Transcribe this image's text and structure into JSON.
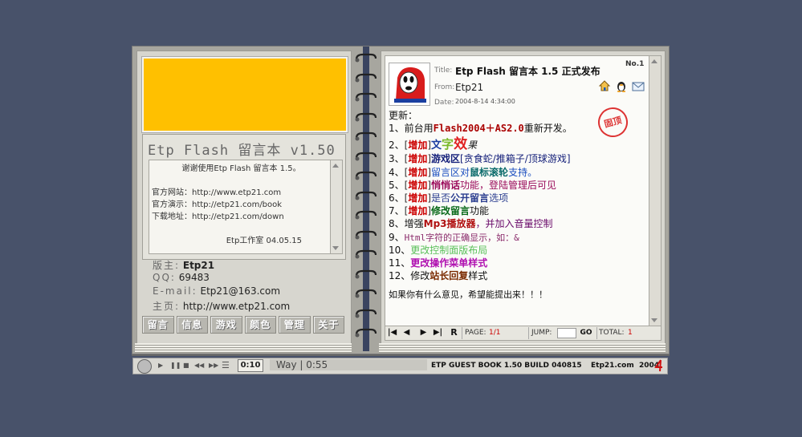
{
  "left": {
    "app_title": "Etp Flash 留言本 v1.50",
    "notice": {
      "lines": [
        "谢谢使用Etp Flash 留言本 1.5。",
        "",
        "官方网站：http://www.etp21.com",
        "官方演示：http://etp21.com/book",
        "下载地址：http://etp21.com/down",
        "",
        "Etp工作室 04.05.15"
      ]
    },
    "info": {
      "owner_label": "版主:",
      "owner": "Etp21",
      "qq_label": "QQ:",
      "qq": "69483",
      "email_label": "E-mail:",
      "email": "Etp21@163.com",
      "home_label": "主页:",
      "home": "http://www.etp21.com"
    },
    "nav": [
      "留言",
      "信息",
      "游戏",
      "颜色",
      "管理",
      "关于"
    ]
  },
  "message": {
    "no": "No.1",
    "title_label": "Title:",
    "title": "Etp Flash 留言本 1.5 正式发布",
    "from_label": "From:",
    "from": "Etp21",
    "date_label": "Date:",
    "date": "2004-8-14 4:34:00",
    "stamp": "固顶",
    "heading": "更新：",
    "item1_pre": "1、前台用",
    "item1_bold": "Flash2004＋AS2.0",
    "item1_post": "重新开发。",
    "item2_num": "2、",
    "item3_num": "3、",
    "item4_num": "4、",
    "item5_num": "5、",
    "item6_num": "6、",
    "item7_num": "7、",
    "add_tag": "增加",
    "lb": "[",
    "rb": "]",
    "item2_a": "文",
    "item2_b": "字",
    "item2_c": "效",
    "item2_d": "果",
    "item3_a": "游戏区",
    "item3_b": "[贪食蛇/推箱子/顶球游戏]",
    "item4_a": "留言区对",
    "item4_b": "鼠标滚轮",
    "item4_c": "支持。",
    "item5_a": "悄悄话",
    "item5_b": "功能，登陆管理后可见",
    "item6_a": "是否",
    "item6_b": "公开留言",
    "item6_c": "选项",
    "item7_a": "修改留言",
    "item7_b": "功能",
    "item8_pre": "8、增强",
    "item8_bold": "Mp3播放器",
    "item8_post": "，并加入音量控制",
    "item9_pre": "9、",
    "item9_text": "Html字符的正确显示，如：&",
    "item10_pre": "10、",
    "item10_text": "更改控制面版布局",
    "item11_pre": "11、",
    "item11_text": "更改操作菜单样式",
    "item12_pre": "12、修改",
    "item12_bold": "站长回复",
    "item12_post": "样式",
    "closing": "如果你有什么意见，希望能提出来！！！"
  },
  "pager": {
    "first_icon": "first-page-icon",
    "prev_icon": "prev-page-icon",
    "next_icon": "next-page-icon",
    "last_icon": "last-page-icon",
    "refresh": "R",
    "page_label": "PAGE:",
    "page": "1/1",
    "jump_label": "JUMP:",
    "jump_value": "",
    "go": "GO",
    "total_label": "TOTAL:",
    "total": "1"
  },
  "player": {
    "time": "0:10",
    "track": "Way | 0:55",
    "build": "ETP GUEST BOOK 1.50 BUILD 040815",
    "site": "Etp21.com",
    "year": "2004"
  },
  "colors": {
    "background": "#48526a",
    "banner": "#ffc000",
    "accent_red": "#cc0000"
  }
}
